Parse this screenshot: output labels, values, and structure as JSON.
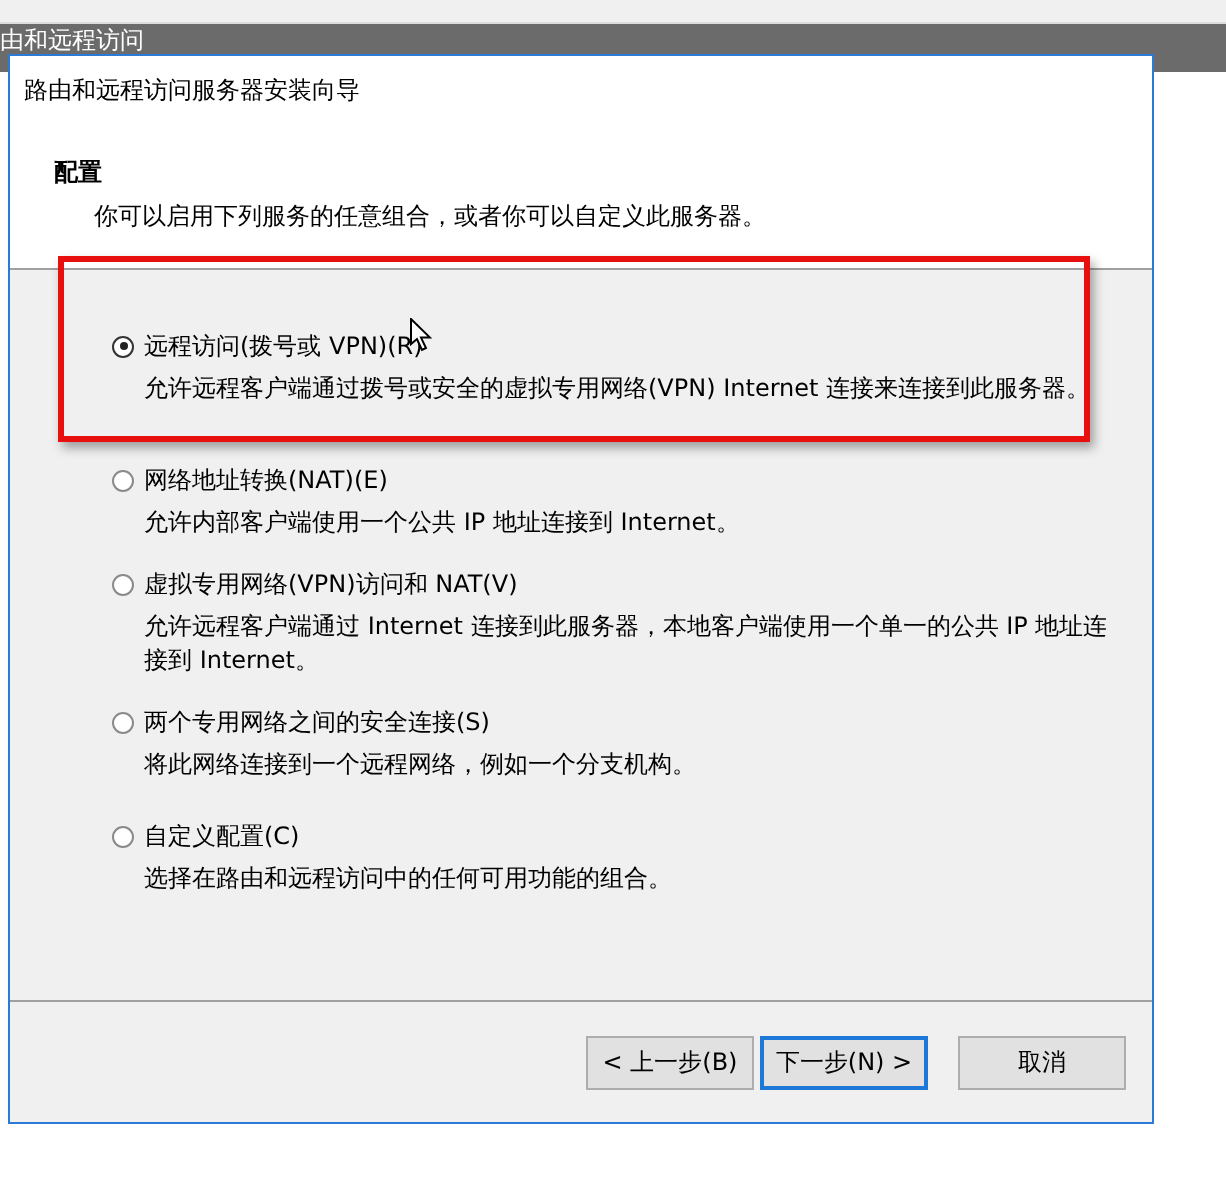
{
  "background_window": {
    "title": "由和远程访问"
  },
  "dialog": {
    "title": "路由和远程访问服务器安装向导",
    "header": {
      "heading": "配置",
      "subtitle": "你可以启用下列服务的任意组合，或者你可以自定义此服务器。"
    },
    "options": [
      {
        "label": "远程访问(拨号或 VPN)(R)",
        "description": "允许远程客户端通过拨号或安全的虚拟专用网络(VPN) Internet 连接来连接到此服务器。",
        "selected": true
      },
      {
        "label": "网络地址转换(NAT)(E)",
        "description": "允许内部客户端使用一个公共 IP 地址连接到 Internet。",
        "selected": false
      },
      {
        "label": "虚拟专用网络(VPN)访问和 NAT(V)",
        "description": "允许远程客户端通过 Internet 连接到此服务器，本地客户端使用一个单一的公共 IP 地址连接到 Internet。",
        "selected": false
      },
      {
        "label": "两个专用网络之间的安全连接(S)",
        "description": "将此网络连接到一个远程网络，例如一个分支机构。",
        "selected": false
      },
      {
        "label": "自定义配置(C)",
        "description": "选择在路由和远程访问中的任何可用功能的组合。",
        "selected": false
      }
    ],
    "buttons": [
      {
        "label": "< 上一步(B)",
        "default": false
      },
      {
        "label": "下一步(N) >",
        "default": true
      },
      {
        "label": "取消",
        "default": false
      }
    ]
  }
}
